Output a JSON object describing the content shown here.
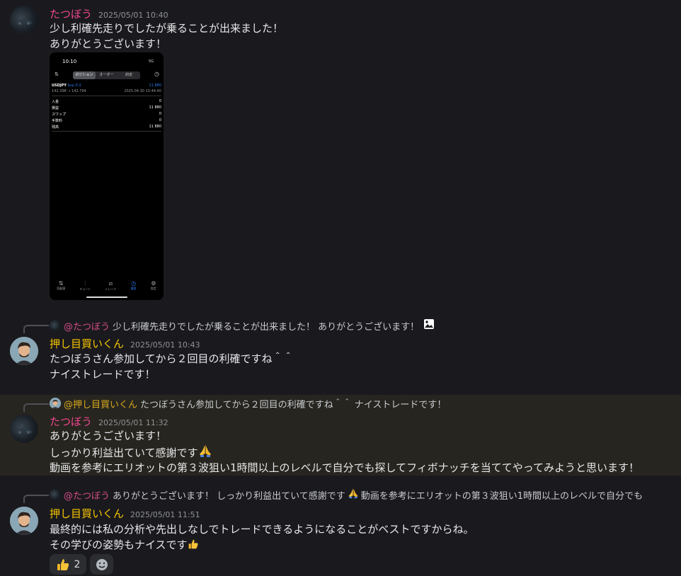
{
  "messages": [
    {
      "user": "たつぼう",
      "time": "2025/05/01 10:40",
      "lines": [
        "少し利確先走りでしたが乗ることが出来ました！",
        "ありがとうございます！"
      ],
      "attachment": {
        "status_time": "10:10",
        "status_signal": "5G",
        "tabs": [
          "ポジション",
          "オーダー",
          "約定"
        ],
        "symbol": "USDJPY",
        "side": "buy 0.3",
        "pl_value": "11 880",
        "price_range": "142.398 → 142.794",
        "open_time": "2025.04.30 15:44:40",
        "rows": [
          {
            "label": "入金",
            "value": "0"
          },
          {
            "label": "損益",
            "value": "11 880"
          },
          {
            "label": "スワップ",
            "value": "0"
          },
          {
            "label": "手数料",
            "value": "0"
          },
          {
            "label": "残高",
            "value": "11 880"
          }
        ],
        "bottom_tabs": [
          "気配値",
          "チャート",
          "トレード",
          "履歴",
          "設定"
        ]
      }
    },
    {
      "reply": {
        "mention": "@たつぼう",
        "text": "少し利確先走りでしたが乗ることが出来ました！ ありがとうございます！"
      },
      "user": "押し目買いくん",
      "time": "2025/05/01 10:43",
      "lines": [
        "たつぼうさん参加してから２回目の利確ですね＾＾",
        "ナイストレードです！"
      ]
    },
    {
      "reply": {
        "mention": "@押し目買いくん",
        "text": "たつぼうさん参加してから２回目の利確ですね＾＾ ナイストレードです！"
      },
      "user": "たつぼう",
      "time": "2025/05/01 11:32",
      "lines": [
        "ありがとうございます！",
        "しっかり利益出ていて感謝です",
        "動画を参考にエリオットの第３波狙い1時間以上のレベルで自分でも探してフィボナッチを当ててやってみようと思います！"
      ]
    },
    {
      "reply": {
        "mention": "@たつぼう",
        "text_a": "ありがとうございます！ しっかり利益出ていて感謝です",
        "text_b": "動画を参考にエリオットの第３波狙い1時間以上のレベルで自分でも"
      },
      "user": "押し目買いくん",
      "time": "2025/05/01 11:51",
      "lines": [
        "最終的には私の分析や先出しなしでトレードできるようになることがベストですからね。",
        "その学びの姿勢もナイスです"
      ],
      "reaction_count": "2"
    }
  ],
  "icons": {
    "image": "image-icon",
    "pray": "folded-hands-icon",
    "thumbs": "thumbs-up-icon",
    "add_reaction": "add-reaction-icon"
  },
  "colors": {
    "background": "#1a1a1e",
    "name_pink": "#f0478f",
    "name_gold": "#f5c400",
    "highlight": "#27251f",
    "accent_blue": "#2f7bf0"
  }
}
